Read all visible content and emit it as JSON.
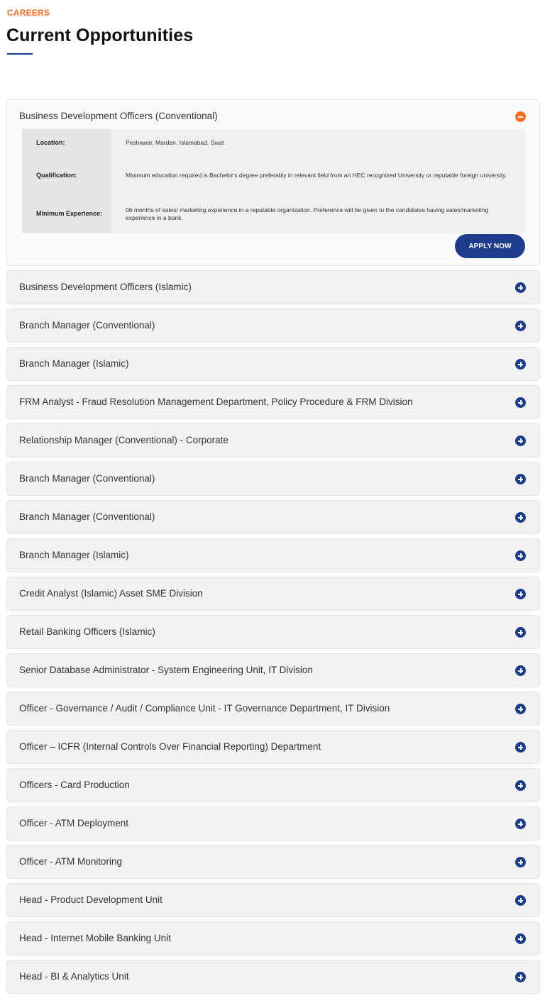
{
  "header": {
    "eyebrow": "CAREERS",
    "title": "Current Opportunities"
  },
  "colors": {
    "accent_orange": "#f36f21",
    "brand_navy": "#1d3c8c"
  },
  "open_item": {
    "title": "Business Development Officers (Conventional)",
    "toggle_icon": "minus-circle-icon",
    "details": [
      {
        "label": "Location:",
        "value": "Peshawar, Mardan, Islamabad, Swat"
      },
      {
        "label": "Qualification:",
        "value": "Minimum education required is Bachelor's degree preferably in relevant field from an HEC recognized University or reputable foreign university."
      },
      {
        "label": "Minimum Experience:",
        "value": "06 months of sales/ marketing experience in a reputable organization. Preference will be given to the candidates having sales/marketing experience in a bank."
      }
    ],
    "apply_label": "APPLY NOW"
  },
  "items": [
    "Business Development Officers (Islamic)",
    "Branch Manager (Conventional)",
    "Branch Manager (Islamic)",
    "FRM Analyst - Fraud Resolution Management Department, Policy Procedure & FRM Division",
    "Relationship Manager (Conventional) - Corporate",
    "Branch Manager (Conventional)",
    "Branch Manager (Conventional)",
    "Branch Manager (Islamic)",
    "Credit Analyst (Islamic) Asset SME Division",
    "Retail Banking Officers (Islamic)",
    "Senior Database Administrator - System Engineering Unit, IT Division",
    "Officer - Governance / Audit / Compliance Unit - IT Governance Department, IT Division",
    "Officer – ICFR (Internal Controls Over Financial Reporting) Department",
    "Officers - Card Production",
    "Officer - ATM Deployment",
    "Officer - ATM Monitoring",
    "Head - Product Development Unit",
    "Head - Internet Mobile Banking Unit",
    "Head - BI & Analytics Unit"
  ],
  "collapsed_icon": "plus-circle-icon"
}
